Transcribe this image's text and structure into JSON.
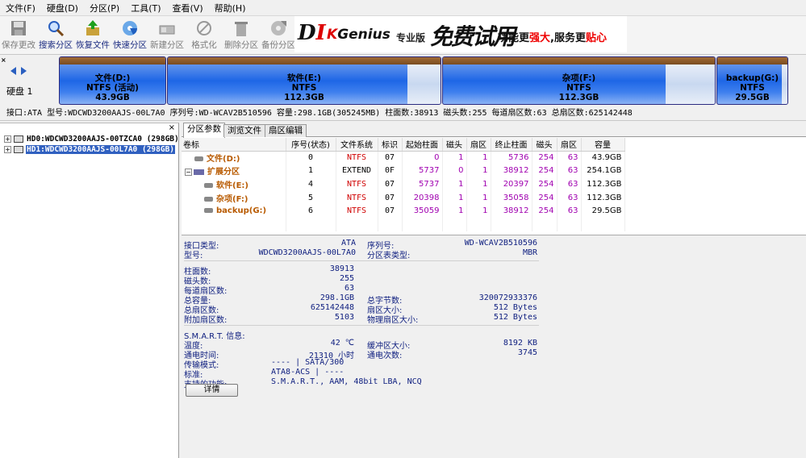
{
  "menu": [
    "文件(F)",
    "硬盘(D)",
    "分区(P)",
    "工具(T)",
    "查看(V)",
    "帮助(H)"
  ],
  "toolbar": [
    {
      "label": "保存更改",
      "icon": "save-icon",
      "enabled": false
    },
    {
      "label": "搜索分区",
      "icon": "search-icon",
      "enabled": true
    },
    {
      "label": "恢复文件",
      "icon": "recover-icon",
      "enabled": true
    },
    {
      "label": "快速分区",
      "icon": "quick-partition-icon",
      "enabled": true
    },
    {
      "label": "新建分区",
      "icon": "new-partition-icon",
      "enabled": false
    },
    {
      "label": "格式化",
      "icon": "format-icon",
      "enabled": false
    },
    {
      "label": "删除分区",
      "icon": "delete-icon",
      "enabled": false
    },
    {
      "label": "备份分区",
      "icon": "backup-icon",
      "enabled": false
    }
  ],
  "banner": {
    "logo_d": "D",
    "logo_i": "I",
    "logo_k": "K",
    "logo_rest": "Genius",
    "edition": "专业版",
    "free": "免费试用",
    "slogan_a": "功能更",
    "slogan_b": "强大",
    "slogan_c": ",服务更",
    "slogan_d": "贴心"
  },
  "disk": {
    "close_glyph": "×",
    "label": "硬盘 1",
    "partitions": [
      {
        "name": "文件(D:)",
        "fs": "NTFS (活动)",
        "size": "43.9GB",
        "used": 1.0
      },
      {
        "name": "软件(E:)",
        "fs": "NTFS",
        "size": "112.3GB",
        "used": 0.88
      },
      {
        "name": "杂项(F:)",
        "fs": "NTFS",
        "size": "112.3GB",
        "used": 0.82
      },
      {
        "name": "backup(G:)",
        "fs": "NTFS",
        "size": "29.5GB",
        "used": 0.92
      }
    ],
    "info": "接口:ATA  型号:WDCWD3200AAJS-00L7A0  序列号:WD-WCAV2B510596  容量:298.1GB(305245MB)  柱面数:38913  磁头数:255  每道扇区数:63  总扇区数:625142448"
  },
  "tree": {
    "close_glyph": "×",
    "nodes": [
      {
        "text": "HD0:WDCWD3200AAJS-00TZCA0 (298GB)",
        "selected": false
      },
      {
        "text": "HD1:WDCWD3200AAJS-00L7A0 (298GB)",
        "selected": true
      }
    ]
  },
  "tabs": [
    "分区参数",
    "浏览文件",
    "扇区编辑"
  ],
  "table": {
    "columns": [
      "卷标",
      "序号(状态)",
      "文件系统",
      "标识",
      "起始柱面",
      "磁头",
      "扇区",
      "终止柱面",
      "磁头",
      "扇区",
      "容量"
    ],
    "rows": [
      {
        "name": "文件(D:)",
        "indent": 1,
        "idx": "0",
        "fs": "NTFS",
        "id": "07",
        "sc": "0",
        "sh": "1",
        "ss": "1",
        "ec": "5736",
        "eh": "254",
        "es": "63",
        "cap": "43.9GB",
        "ext": false
      },
      {
        "name": "扩展分区",
        "indent": 0,
        "idx": "1",
        "fs": "EXTEND",
        "id": "0F",
        "sc": "5737",
        "sh": "0",
        "ss": "1",
        "ec": "38912",
        "eh": "254",
        "es": "63",
        "cap": "254.1GB",
        "ext": true
      },
      {
        "name": "软件(E:)",
        "indent": 2,
        "idx": "4",
        "fs": "NTFS",
        "id": "07",
        "sc": "5737",
        "sh": "1",
        "ss": "1",
        "ec": "20397",
        "eh": "254",
        "es": "63",
        "cap": "112.3GB",
        "ext": false
      },
      {
        "name": "杂项(F:)",
        "indent": 2,
        "idx": "5",
        "fs": "NTFS",
        "id": "07",
        "sc": "20398",
        "sh": "1",
        "ss": "1",
        "ec": "35058",
        "eh": "254",
        "es": "63",
        "cap": "112.3GB",
        "ext": false
      },
      {
        "name": "backup(G:)",
        "indent": 2,
        "idx": "6",
        "fs": "NTFS",
        "id": "07",
        "sc": "35059",
        "sh": "1",
        "ss": "1",
        "ec": "38912",
        "eh": "254",
        "es": "63",
        "cap": "29.5GB",
        "ext": false
      }
    ]
  },
  "details": {
    "iface_label": "接口类型:",
    "iface": "ATA",
    "model_label": "型号:",
    "model": "WDCWD3200AAJS-00L7A0",
    "serial_label": "序列号:",
    "serial": "WD-WCAV2B510596",
    "ptype_label": "分区表类型:",
    "ptype": "MBR",
    "cyl_label": "柱面数:",
    "cyl": "38913",
    "heads_label": "磁头数:",
    "heads": "255",
    "spt_label": "每道扇区数:",
    "spt": "63",
    "cap_label": "总容量:",
    "cap": "298.1GB",
    "bytes_label": "总字节数:",
    "bytes": "320072933376",
    "sectors_label": "总扇区数:",
    "sectors": "625142448",
    "secsize_label": "扇区大小:",
    "secsize": "512 Bytes",
    "extra_label": "附加扇区数:",
    "extra": "5103",
    "physsec_label": "物理扇区大小:",
    "physsec": "512 Bytes",
    "smart_label": "S.M.A.R.T. 信息:",
    "temp_label": "温度:",
    "temp": "42 ℃",
    "buffer_label": "缓冲区大小:",
    "buffer": "8192 KB",
    "hours_label": "通电时间:",
    "hours": "21310 小时",
    "count_label": "通电次数:",
    "count": "3745",
    "mode_label": "传输模式:",
    "mode": "---- | SATA/300",
    "std_label": "标准:",
    "std": "ATA8-ACS | ----",
    "feat_label": "支持的功能:",
    "feat": "S.M.A.R.T., AAM, 48bit LBA, NCQ",
    "button": "详情"
  }
}
